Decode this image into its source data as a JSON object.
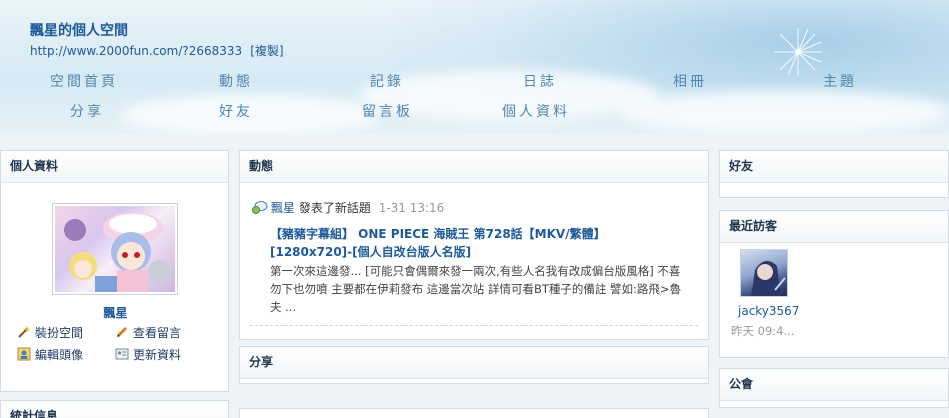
{
  "header": {
    "title": "飄星的個人空間",
    "url": "http://www.2000fun.com/?2668333",
    "copy_label": "[複製]",
    "nav": [
      "空間首頁",
      "動態",
      "記錄",
      "日誌",
      "相冊",
      "主題",
      "分享",
      "好友",
      "留言板",
      "個人資料"
    ]
  },
  "profile_panel": {
    "title": "個人資料",
    "name": "飄星",
    "actions": {
      "decorate": "裝扮空間",
      "view_messages": "查看留言",
      "edit_avatar": "編輯頭像",
      "update_profile": "更新資料"
    }
  },
  "stats_panel": {
    "title": "統計信息"
  },
  "feed_panel": {
    "title": "動態",
    "item": {
      "user": "飄星",
      "action": "發表了新話題",
      "time": "1-31 13:16",
      "topic": "【豬豬字幕組】 ONE PIECE 海賊王 第728話【MKV/繁體】[1280x720]-[個人自改台版人名版]",
      "excerpt": "第一次來這邊發... [可能只會偶爾來發一兩次,有些人名我有改成偏台版風格] 不喜勿下也勿噴 主要都在伊莉發布 這邊當次站 詳情可看BT種子的備註 譬如:路飛>魯夫 ..."
    }
  },
  "share_panel": {
    "title": "分享"
  },
  "friends_panel": {
    "title": "好友"
  },
  "visitors_panel": {
    "title": "最近訪客",
    "visitor": {
      "name": "jacky3567",
      "time": "昨天 09:4..."
    }
  },
  "notice_panel": {
    "title": "公會"
  },
  "colors": {
    "link": "#1e5a9a",
    "nav": "#4f86b3",
    "panel_border": "#d3dde4"
  }
}
